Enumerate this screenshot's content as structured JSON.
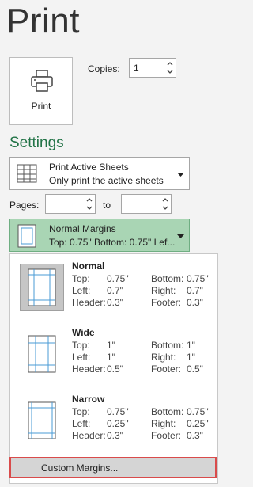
{
  "title": "Print",
  "print_button": {
    "label": "Print"
  },
  "copies": {
    "label": "Copies:",
    "value": "1"
  },
  "settings_heading": "Settings",
  "sheets_dropdown": {
    "line1": "Print Active Sheets",
    "line2": "Only print the active sheets"
  },
  "pages": {
    "label": "Pages:",
    "to_label": "to",
    "from_value": "",
    "to_value": ""
  },
  "margins_dropdown": {
    "line1": "Normal Margins",
    "line2": "Top: 0.75\" Bottom: 0.75\" Lef..."
  },
  "margin_options": [
    {
      "name": "Normal",
      "selected": true,
      "top_label": "Top:",
      "top": "0.75\"",
      "bottom_label": "Bottom:",
      "bottom": "0.75\"",
      "left_label": "Left:",
      "left": "0.7\"",
      "right_label": "Right:",
      "right": "0.7\"",
      "header_label": "Header:",
      "header": "0.3\"",
      "footer_label": "Footer:",
      "footer": "0.3\""
    },
    {
      "name": "Wide",
      "selected": false,
      "top_label": "Top:",
      "top": "1\"",
      "bottom_label": "Bottom:",
      "bottom": "1\"",
      "left_label": "Left:",
      "left": "1\"",
      "right_label": "Right:",
      "right": "1\"",
      "header_label": "Header:",
      "header": "0.5\"",
      "footer_label": "Footer:",
      "footer": "0.5\""
    },
    {
      "name": "Narrow",
      "selected": false,
      "top_label": "Top:",
      "top": "0.75\"",
      "bottom_label": "Bottom:",
      "bottom": "0.75\"",
      "left_label": "Left:",
      "left": "0.25\"",
      "right_label": "Right:",
      "right": "0.25\"",
      "header_label": "Header:",
      "header": "0.3\"",
      "footer_label": "Footer:",
      "footer": "0.3\""
    }
  ],
  "custom_margins": {
    "label": "Custom Margins..."
  },
  "colors": {
    "accent": "#217346",
    "margins_highlight": "#a9d5b4",
    "custom_outline": "#d94b4b"
  }
}
